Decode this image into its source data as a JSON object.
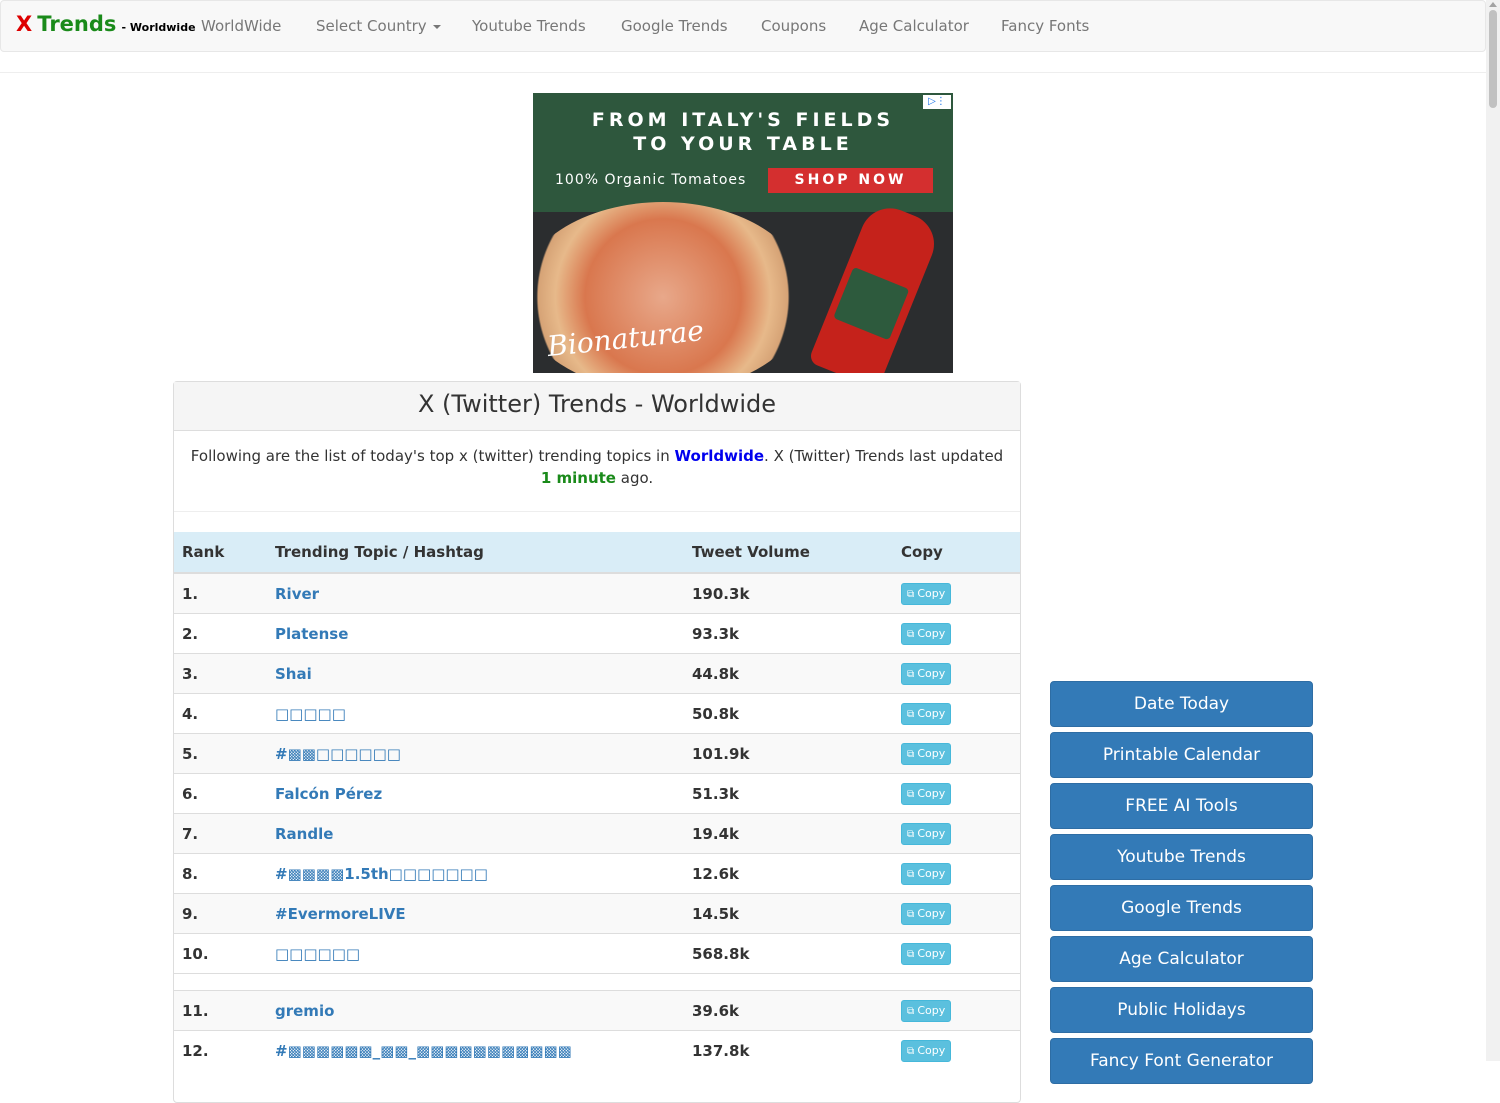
{
  "navbar": {
    "brand_x": "X",
    "brand_trends": "Trends",
    "brand_sub": "- Worldwide",
    "items": [
      "WorldWide",
      "Select Country",
      "Youtube Trends",
      "Google Trends",
      "Coupons",
      "Age Calculator",
      "Fancy Fonts"
    ]
  },
  "ad": {
    "line1": "FROM ITALY'S FIELDS",
    "line2": "TO YOUR TABLE",
    "organic": "100% Organic Tomatoes",
    "cta": "SHOP NOW",
    "logo": "Bionaturae"
  },
  "panel": {
    "title": "X (Twitter) Trends - Worldwide",
    "intro_before": "Following are the list of today's top x (twitter) trending topics in ",
    "location": "Worldwide",
    "intro_mid": ". X (Twitter) Trends last updated ",
    "updated": "1 minute",
    "intro_after": " ago."
  },
  "table": {
    "headers": [
      "Rank",
      "Trending Topic / Hashtag",
      "Tweet Volume",
      "Copy"
    ],
    "copy_label": "Copy",
    "rows": [
      {
        "rank": "1.",
        "topic": "River",
        "volume": "190.3k"
      },
      {
        "rank": "2.",
        "topic": "Platense",
        "volume": "93.3k"
      },
      {
        "rank": "3.",
        "topic": "Shai",
        "volume": "44.8k"
      },
      {
        "rank": "4.",
        "topic": "□□□□□",
        "volume": "50.8k"
      },
      {
        "rank": "5.",
        "topic": "#▩▩□□□□□□",
        "volume": "101.9k"
      },
      {
        "rank": "6.",
        "topic": "Falcón Pérez",
        "volume": "51.3k"
      },
      {
        "rank": "7.",
        "topic": "Randle",
        "volume": "19.4k"
      },
      {
        "rank": "8.",
        "topic": "#▩▩▩▩1.5th□□□□□□□",
        "volume": "12.6k"
      },
      {
        "rank": "9.",
        "topic": "#EvermoreLIVE",
        "volume": "14.5k"
      },
      {
        "rank": "10.",
        "topic": "□□□□□□",
        "volume": "568.8k"
      },
      {
        "rank": "11.",
        "topic": "gremio",
        "volume": "39.6k"
      },
      {
        "rank": "12.",
        "topic": "#▩▩▩▩▩▩_▩▩_▩▩▩▩▩▩▩▩▩▩▩",
        "volume": "137.8k"
      }
    ]
  },
  "sidebar": [
    "Date Today",
    "Printable Calendar",
    "FREE AI Tools",
    "Youtube Trends",
    "Google Trends",
    "Age Calculator",
    "Public Holidays",
    "Fancy Font Generator"
  ]
}
